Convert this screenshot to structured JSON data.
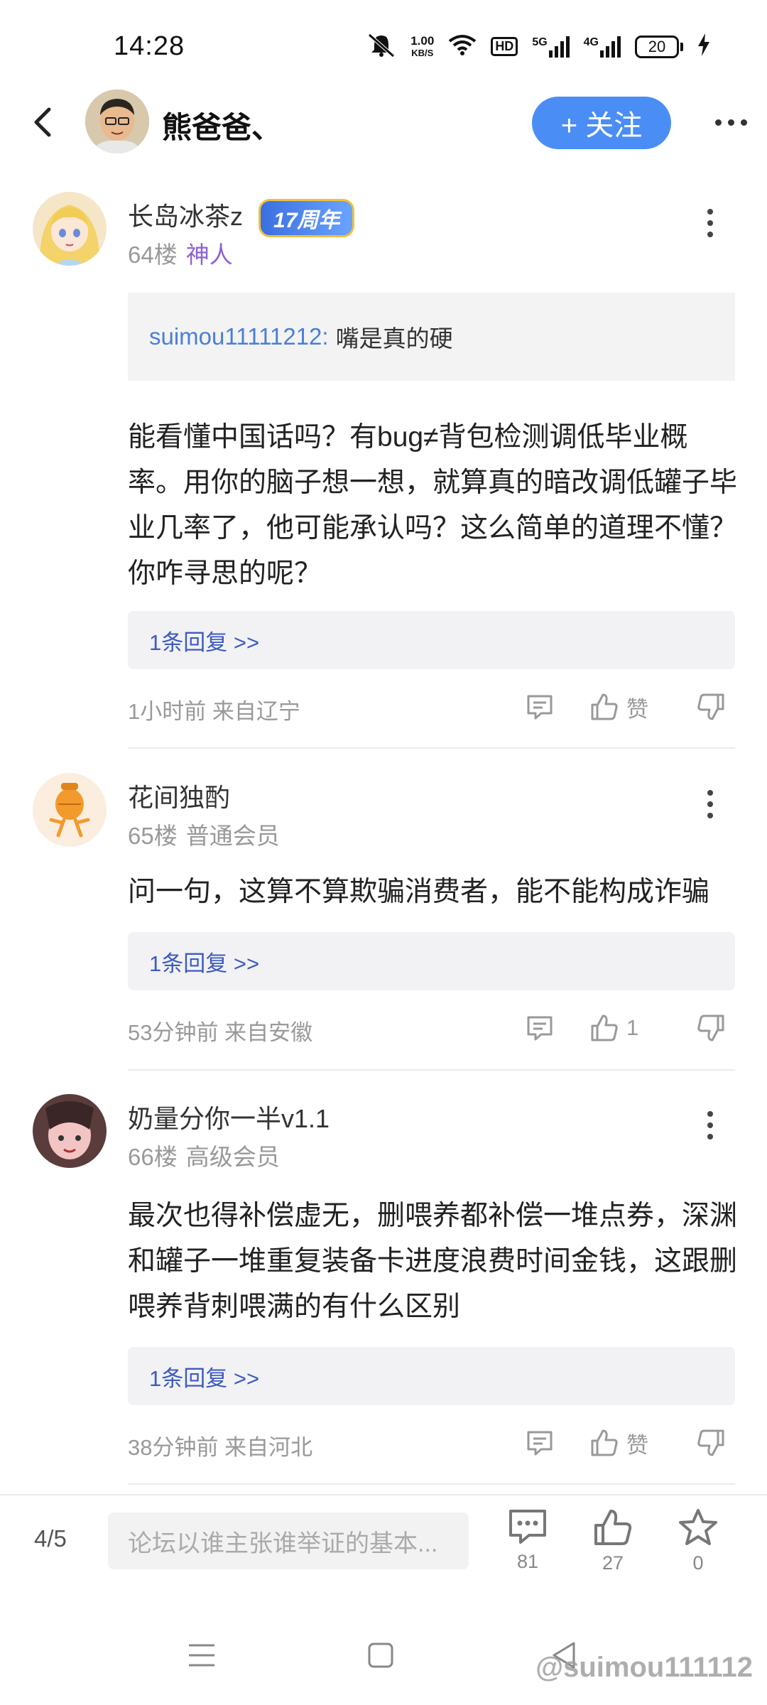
{
  "status_bar": {
    "time": "14:28",
    "net_speed_value": "1.00",
    "net_speed_unit": "KB/S",
    "hd_badge": "HD",
    "signal1_label": "5G",
    "signal2_label": "4G",
    "battery": "20",
    "icons": [
      "mute-icon",
      "wifi-icon",
      "hd-icon",
      "signal-5g-icon",
      "signal-4g-icon",
      "battery-icon",
      "charging-icon"
    ]
  },
  "header": {
    "back_icon": "back-arrow-icon",
    "username": "熊爸爸、",
    "follow_label": "+ 关注",
    "more_icon": "more-icon",
    "accent_color": "#4a8ef5"
  },
  "comments": [
    {
      "user": "长岛冰茶z",
      "badge": "17周年",
      "floor": "64楼",
      "level": "神人",
      "quote": {
        "user": "suimou11111212:",
        "text": "嘴是真的硬"
      },
      "text": "能看懂中国话吗？有bug≠背包检测调低毕业概率。用你的脑子想一想，就算真的暗改调低罐子毕业几率了，他可能承认吗？这么简单的道理不懂？你咋寻思的呢？",
      "replies": "1条回复 >>",
      "time": "1小时前 来自辽宁",
      "like_label": "赞"
    },
    {
      "user": "花间独酌",
      "floor": "65楼",
      "level": "普通会员",
      "text": "问一句，这算不算欺骗消费者，能不能构成诈骗",
      "replies": "1条回复 >>",
      "time": "53分钟前 来自安徽",
      "like_label": "1"
    },
    {
      "user": "奶量分你一半v1.1",
      "floor": "66楼",
      "level": "高级会员",
      "text": "最次也得补偿虚无，删喂养都补偿一堆点券，深渊和罐子一堆重复装备卡进度浪费时间金钱，这跟删喂养背刺喂满的有什么区别",
      "replies": "1条回复 >>",
      "time": "38分钟前 来自河北",
      "like_label": "赞"
    }
  ],
  "bottom_bar": {
    "page": "4/5",
    "input_placeholder": "论坛以谁主张谁举证的基本...",
    "comments_count": "81",
    "likes_count": "27",
    "favorites_count": "0"
  },
  "nav": {
    "icons": [
      "menu-icon",
      "home-icon",
      "back-icon"
    ]
  },
  "watermark": "@suimou111112"
}
